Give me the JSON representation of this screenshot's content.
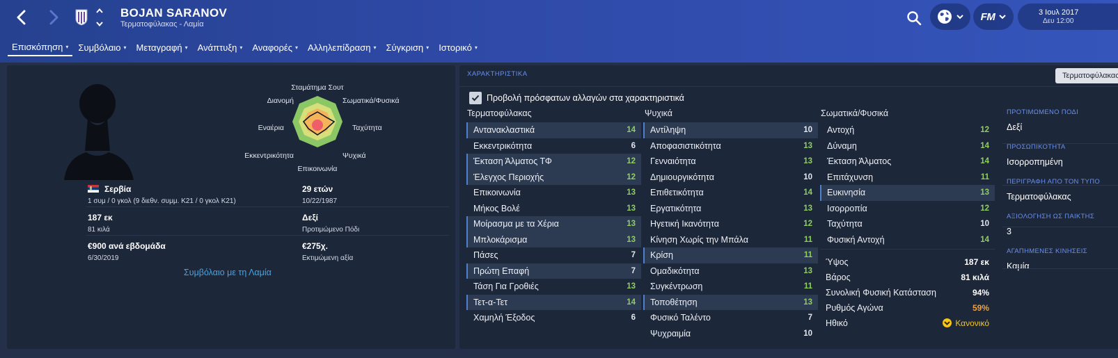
{
  "header": {
    "player_name": "BOJAN SARANOV",
    "player_sub": "Τερματοφύλακας - Λαμία",
    "date": "3 Ιουλ 2017",
    "time": "Δευ 12:00",
    "fm_logo": "FM"
  },
  "tabs": [
    {
      "label": "Επισκόπηση"
    },
    {
      "label": "Συμβόλαιο"
    },
    {
      "label": "Μεταγραφή"
    },
    {
      "label": "Ανάπτυξη"
    },
    {
      "label": "Αναφορές"
    },
    {
      "label": "Αλληλεπίδραση"
    },
    {
      "label": "Σύγκριση"
    },
    {
      "label": "Ιστορικό"
    }
  ],
  "radar": {
    "labels": {
      "top": "Σταμάτημα Σουτ",
      "top_left": "Διανομή",
      "top_right": "Σωματικά/Φυσικά",
      "left": "Εναέρια",
      "right": "Ταχύτητα",
      "bottom_left": "Εκκεντρικότητα",
      "bottom_right": "Ψυχικά",
      "bottom": "Επικοινωνία"
    }
  },
  "info": {
    "nation": "Σερβία",
    "caps": "1 συμ / 0 γκολ (9 διεθν. συμμ. Κ21 / 0 γκολ Κ21)",
    "age": "29 ετών",
    "dob": "10/22/1987",
    "height": "187 εκ",
    "weight": "81 κιλά",
    "foot": "Δεξί",
    "foot_label": "Προτιμώμενο Πόδι",
    "wage": "€900 ανά εβδομάδα",
    "contract_end": "6/30/2019",
    "value": "€275χ.",
    "value_label": "Εκτιμώμενη αξία",
    "contract_link": "Συμβόλαιο με τη Λαμία"
  },
  "attributes": {
    "title": "ΧΑΡΑΚΤΗΡΙΣΤΙΚΑ",
    "dropdown": "Τερματοφύλακας",
    "recent_changes_label": "Προβολή πρόσφατων αλλαγών στα χαρακτηριστικά",
    "goalkeeping_head": "Τερματοφύλακας",
    "mental_head": "Ψυχικά",
    "physical_head": "Σωματικά/Φυσικά",
    "goalkeeping": [
      {
        "name": "Αντανακλαστικά",
        "value": "14",
        "hl": true
      },
      {
        "name": "Εκκεντρικότητα",
        "value": "6",
        "hl": false
      },
      {
        "name": "Έκταση Άλματος ΤΦ",
        "value": "12",
        "hl": true
      },
      {
        "name": "Έλεγχος Περιοχής",
        "value": "12",
        "hl": true
      },
      {
        "name": "Επικοινωνία",
        "value": "13",
        "hl": false
      },
      {
        "name": "Μήκος Βολέ",
        "value": "13",
        "hl": false
      },
      {
        "name": "Μοίρασμα με τα Χέρια",
        "value": "13",
        "hl": true
      },
      {
        "name": "Μπλοκάρισμα",
        "value": "13",
        "hl": true
      },
      {
        "name": "Πάσες",
        "value": "7",
        "hl": false
      },
      {
        "name": "Πρώτη Επαφή",
        "value": "7",
        "hl": true
      },
      {
        "name": "Τάση Για Γροθιές",
        "value": "13",
        "hl": false
      },
      {
        "name": "Τετ-α-Τετ",
        "value": "14",
        "hl": true
      },
      {
        "name": "Χαμηλή Έξοδος",
        "value": "6",
        "hl": false
      }
    ],
    "mental": [
      {
        "name": "Αντίληψη",
        "value": "10",
        "hl": true
      },
      {
        "name": "Αποφασιστικότητα",
        "value": "13",
        "hl": false
      },
      {
        "name": "Γενναιότητα",
        "value": "13",
        "hl": false
      },
      {
        "name": "Δημιουργικότητα",
        "value": "10",
        "hl": false
      },
      {
        "name": "Επιθετικότητα",
        "value": "14",
        "hl": false
      },
      {
        "name": "Εργατικότητα",
        "value": "13",
        "hl": false
      },
      {
        "name": "Ηγετική Ικανότητα",
        "value": "12",
        "hl": false
      },
      {
        "name": "Κίνηση Χωρίς την Μπάλα",
        "value": "11",
        "hl": false
      },
      {
        "name": "Κρίση",
        "value": "11",
        "hl": true
      },
      {
        "name": "Ομαδικότητα",
        "value": "13",
        "hl": false
      },
      {
        "name": "Συγκέντρωση",
        "value": "11",
        "hl": false
      },
      {
        "name": "Τοποθέτηση",
        "value": "13",
        "hl": true
      },
      {
        "name": "Φυσικό Ταλέντο",
        "value": "7",
        "hl": false
      },
      {
        "name": "Ψυχραιμία",
        "value": "10",
        "hl": false
      }
    ],
    "physical": [
      {
        "name": "Αντοχή",
        "value": "12",
        "hl": false
      },
      {
        "name": "Δύναμη",
        "value": "14",
        "hl": false
      },
      {
        "name": "Έκταση Άλματος",
        "value": "14",
        "hl": false
      },
      {
        "name": "Επιτάχυνση",
        "value": "11",
        "hl": false
      },
      {
        "name": "Ευκινησία",
        "value": "13",
        "hl": true
      },
      {
        "name": "Ισορροπία",
        "value": "12",
        "hl": false
      },
      {
        "name": "Ταχύτητα",
        "value": "10",
        "hl": false
      },
      {
        "name": "Φυσική Αντοχή",
        "value": "14",
        "hl": false
      }
    ],
    "physical_info": [
      {
        "name": "Ύψος",
        "value": "187 εκ",
        "style": "white"
      },
      {
        "name": "Βάρος",
        "value": "81 κιλά",
        "style": "white"
      },
      {
        "name": "Συνολική Φυσική Κατάσταση",
        "value": "94%",
        "style": "white"
      },
      {
        "name": "Ρυθμός Αγώνα",
        "value": "59%",
        "style": "orange"
      },
      {
        "name": "Ηθικό",
        "value": "Κανονικό",
        "style": "yellow"
      }
    ]
  },
  "side": [
    {
      "head": "ΠΡΟΤΙΜΩΜΕΝΟ ΠΟΔΙ",
      "value": "Δεξί"
    },
    {
      "head": "ΠΡΟΣΩΠΙΚΟΤΗΤΑ",
      "value": "Ισορροπημένη"
    },
    {
      "head": "ΠΕΡΙΓΡΑΦΗ ΑΠΟ ΤΟΝ ΤΥΠΟ",
      "value": "Τερματοφύλακας"
    },
    {
      "head": "ΑΞΙΟΛΟΓΗΣΗ ΩΣ ΠΑΙΚΤΗΣ",
      "value": "3"
    },
    {
      "head": "ΑΓΑΠΗΜΕΝΕΣ ΚΙΝΗΣΕΙΣ",
      "value": "Καμία"
    }
  ],
  "colors": {
    "header_blue": "#2f4aa8",
    "panel_bg": "#1d273a",
    "attr_good": "#8ed15a",
    "link": "#4aa3e0",
    "section_head": "#6a90ee",
    "match_sharpness": "#f0a23a",
    "morale": "#f5c518"
  }
}
